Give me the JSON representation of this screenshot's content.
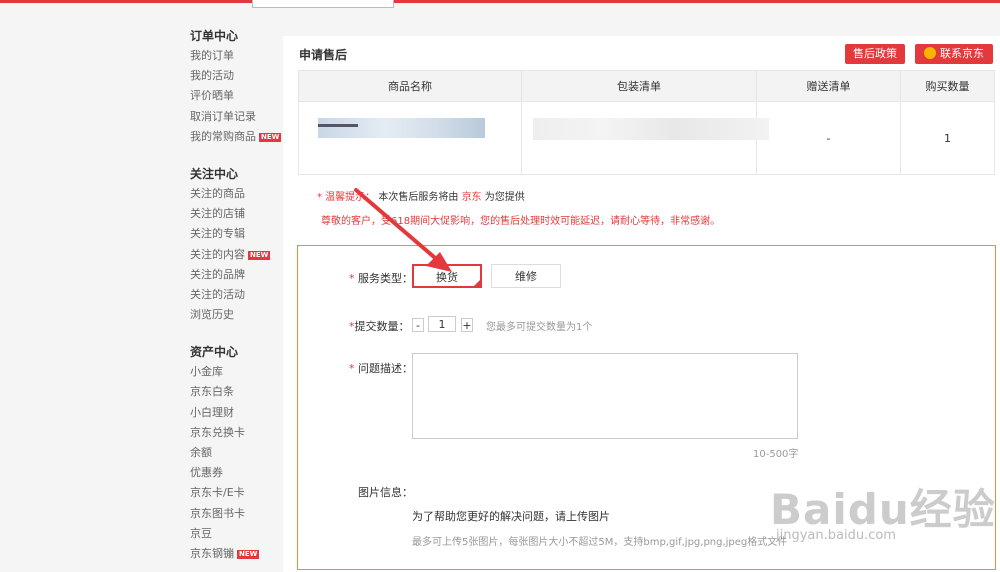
{
  "sidebar": {
    "groups": [
      {
        "title": "订单中心",
        "items": [
          "我的订单",
          "我的活动",
          "评价晒单",
          "取消订单记录",
          "我的常购商品"
        ]
      },
      {
        "title": "关注中心",
        "items": [
          "关注的商品",
          "关注的店铺",
          "关注的专辑",
          "关注的内容",
          "关注的品牌",
          "关注的活动",
          "浏览历史"
        ]
      },
      {
        "title": "资产中心",
        "items": [
          "小金库",
          "京东白条",
          "小白理财",
          "京东兑换卡",
          "余额",
          "优惠券",
          "京东卡/E卡",
          "京东图书卡",
          "京豆",
          "京东钢镚"
        ]
      }
    ],
    "new_badge": "NEW"
  },
  "main": {
    "title": "申请售后",
    "policy_button": "售后政策",
    "contact_button": "联系京东"
  },
  "goods_table": {
    "headers": [
      "商品名称",
      "包装清单",
      "赠送清单",
      "购买数量"
    ],
    "row": {
      "gift": "-",
      "qty": "1"
    }
  },
  "tips": {
    "label": "* 温馨提示：",
    "text_before": "本次售后服务将由",
    "seller": "京东",
    "text_after": "为您提供",
    "notice": "尊敬的客户，受618期间大促影响，您的售后处理时效可能延迟，请耐心等待，非常感谢。"
  },
  "form": {
    "service_type_label": "服务类型：",
    "service_options": [
      "换货",
      "维修"
    ],
    "quantity_label": "提交数量：",
    "quantity_minus": "-",
    "quantity_value": "1",
    "quantity_plus": "+",
    "quantity_hint": "您最多可提交数量为1个",
    "desc_label": "问题描述：",
    "desc_counter": "10-500字",
    "image_label": "图片信息：",
    "image_title": "为了帮助您更好的解决问题，请上传图片",
    "image_hint": "最多可上传5张图片，每张图片大小不超过5M，支持bmp,gif,jpg,png,jpeg格式文件"
  },
  "watermark": {
    "text": "Baidu经验",
    "sub": "jingyan.baidu.com"
  },
  "colors": {
    "accent": "#e4393c",
    "form_border": "#f08a3c"
  }
}
